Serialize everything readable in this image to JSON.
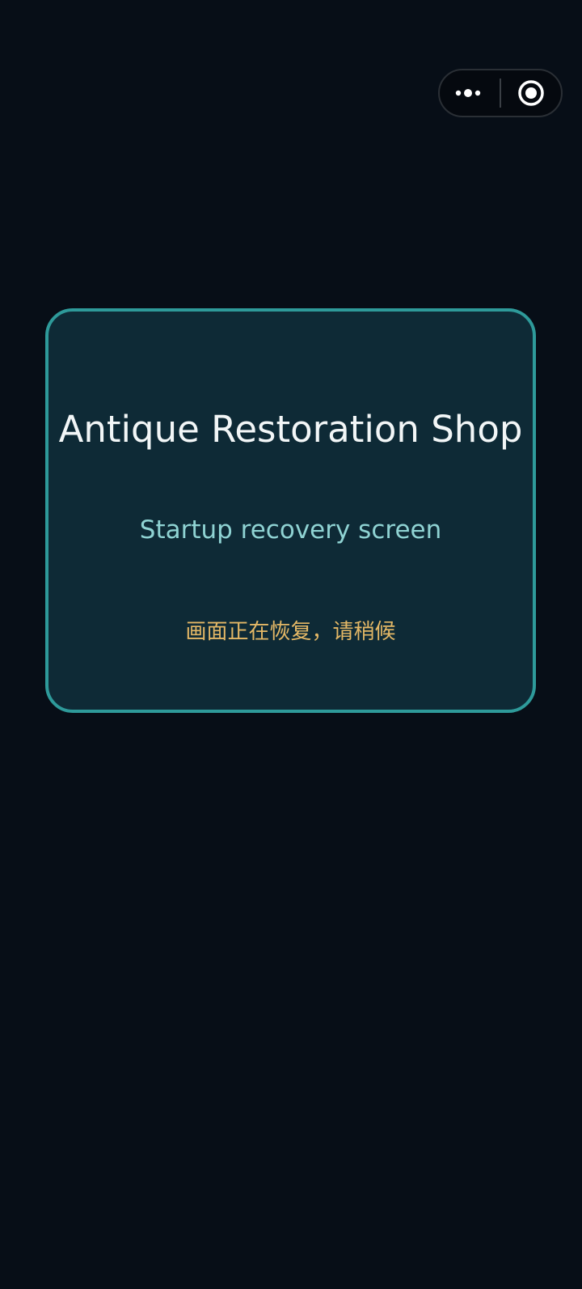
{
  "capsule": {
    "more_icon": "more-dots-icon",
    "close_icon": "target-circle-icon"
  },
  "card": {
    "title": "Antique Restoration Shop",
    "subtitle": "Startup recovery screen",
    "status": "画面正在恢复，请稍候"
  },
  "colors": {
    "background": "#070e17",
    "card_background": "#0e2a36",
    "card_border": "#2e9a9a",
    "title": "#f2f6f7",
    "subtitle": "#8fd3d3",
    "status": "#e4b866"
  }
}
